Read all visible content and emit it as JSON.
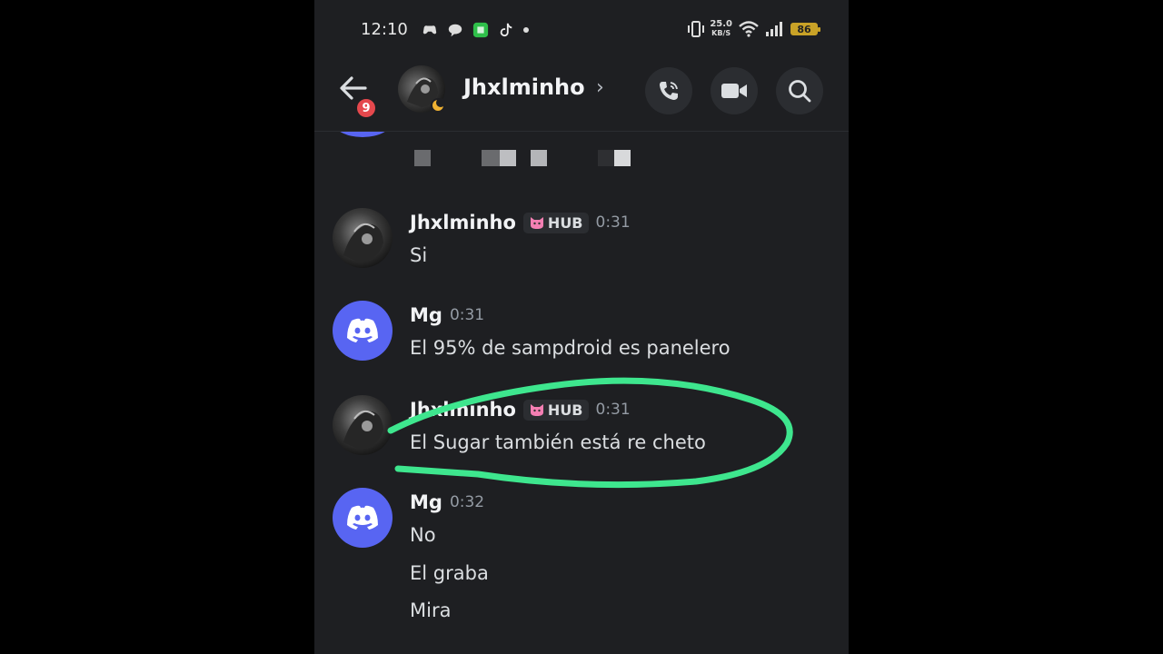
{
  "status_bar": {
    "time": "12:10",
    "speed_value": "25.0",
    "speed_unit": "KB/S",
    "battery": "86"
  },
  "header": {
    "unread_count": "9",
    "contact_name": "Jhxlminho",
    "chevron": "›"
  },
  "messages": [
    {
      "author": "Jhxlminho",
      "tag": "HUB",
      "time": "0:31",
      "lines": [
        "Si"
      ]
    },
    {
      "author": "Mg",
      "time": "0:31",
      "lines": [
        "El 95% de sampdroid es panelero"
      ]
    },
    {
      "author": "Jhxlminho",
      "tag": "HUB",
      "time": "0:31",
      "lines": [
        "El Sugar también está re cheto"
      ]
    },
    {
      "author": "Mg",
      "time": "0:32",
      "lines": [
        "No",
        "El graba",
        "Mira"
      ]
    }
  ],
  "colors": {
    "background": "#1e1f22",
    "discord_blurple": "#5865f2",
    "badge_red": "#e5484d",
    "annotation_green": "#3ee68e"
  },
  "icons": [
    "arrow-left-icon",
    "phone-icon",
    "video-icon",
    "search-icon",
    "discord-logo-icon",
    "cat-tag-icon",
    "moon-status-icon",
    "wifi-icon",
    "signal-icon",
    "battery-icon"
  ]
}
